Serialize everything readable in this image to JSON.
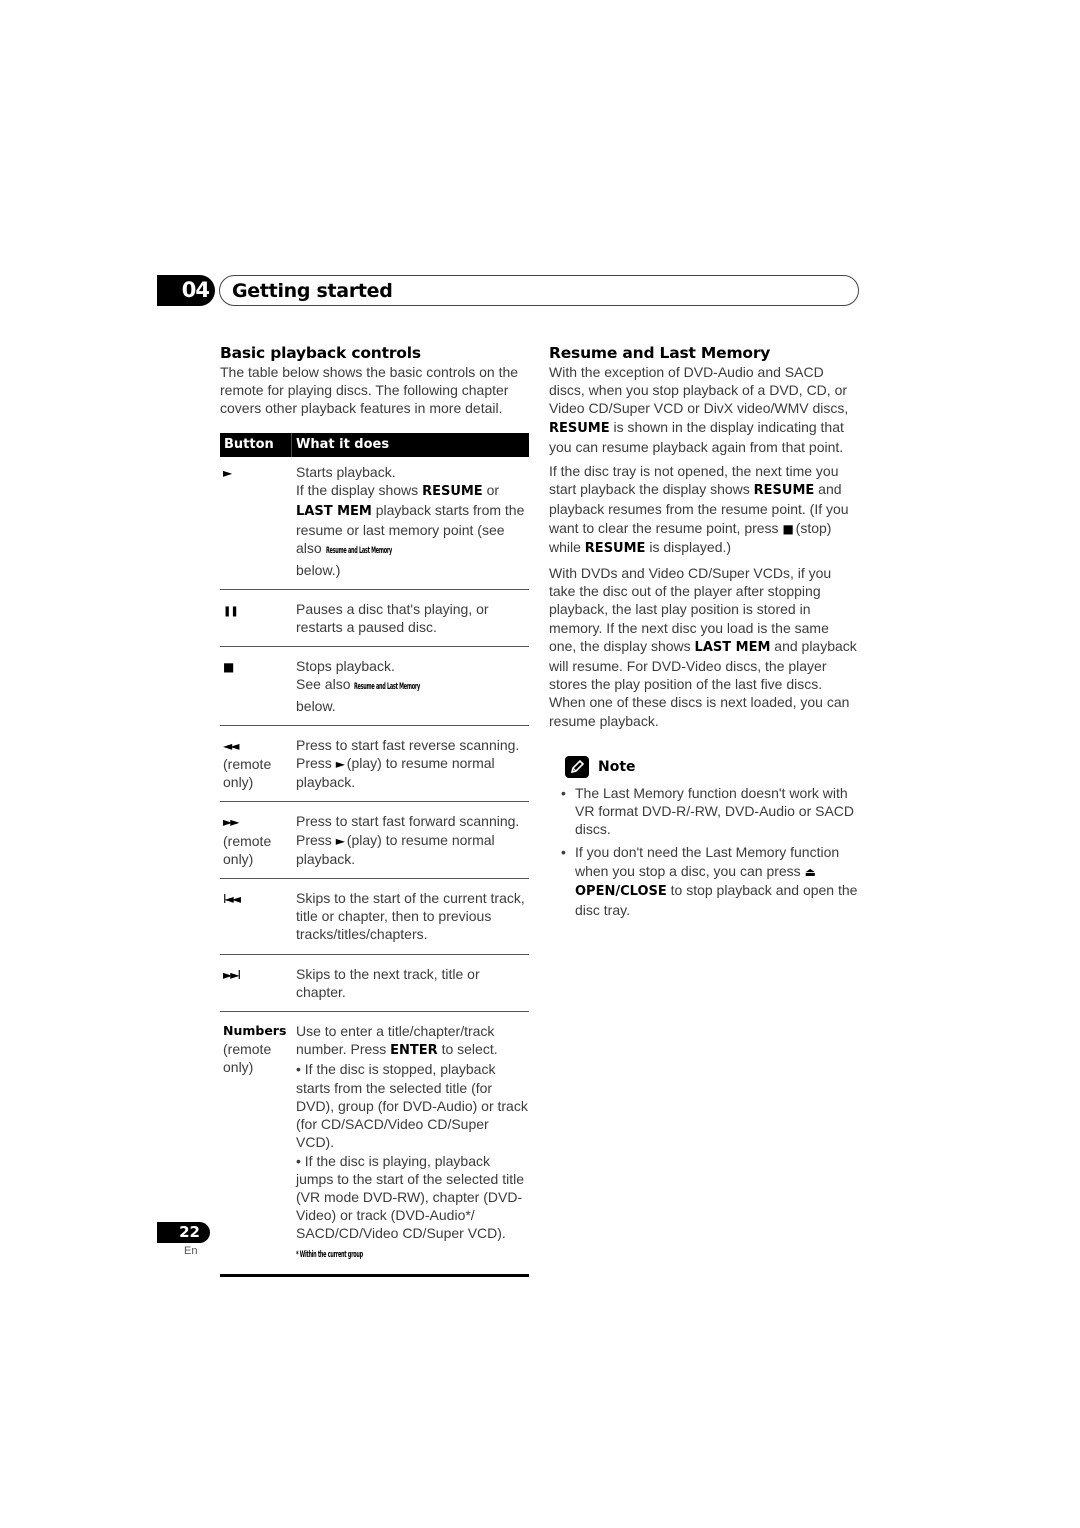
{
  "chapter": {
    "number": "04",
    "title": "Getting started"
  },
  "left": {
    "heading": "Basic playback controls",
    "intro": "The table below shows the basic controls on the remote for playing discs. The following chapter covers other playback features in more detail.",
    "table": {
      "headers": [
        "Button",
        "What it does"
      ],
      "rows": [
        {
          "icon": "play-icon",
          "glyph": "►",
          "sub": "",
          "lines": [
            "Starts playback.",
            "If the display shows ",
            "RESUME",
            " or ",
            "LAST MEM",
            " playback starts from the resume or last memory point (see also ",
            "Resume and Last Memory",
            "below.)"
          ]
        },
        {
          "icon": "pause-icon",
          "glyph": "❚❚",
          "sub": "",
          "text": "Pauses a disc that's playing, or restarts a paused disc."
        },
        {
          "icon": "stop-icon",
          "glyph": "■",
          "sub": "",
          "line1": "Stops playback.",
          "line2": "See also ",
          "ref": "Resume and Last Memory",
          "line3": "below."
        },
        {
          "icon": "fast-reverse-icon",
          "glyph": "◄◄",
          "sub": "(remote only)",
          "text1": "Press to start fast reverse scanning.",
          "text2a": "Press ",
          "text2b": "►",
          "text2c": " (play) to resume normal playback."
        },
        {
          "icon": "fast-forward-icon",
          "glyph": "►►",
          "sub": "(remote only)",
          "text1": "Press to start fast forward scanning.",
          "text2a": "Press ",
          "text2b": "►",
          "text2c": " (play) to resume normal playback."
        },
        {
          "icon": "skip-previous-icon",
          "glyph": "I◄◄",
          "sub": "",
          "text": "Skips to the start of the current track, title or chapter, then to previous tracks/titles/chapters."
        },
        {
          "icon": "skip-next-icon",
          "glyph": "►►I",
          "sub": "",
          "text": "Skips to the next track, title or chapter."
        },
        {
          "label": "Numbers",
          "sub": "(remote only)",
          "text1a": "Use to enter a title/chapter/track number. Press ",
          "text1b": "ENTER",
          "text1c": " to select.",
          "bullet1": "• If the disc is stopped, playback starts from the selected title (for DVD), group (for DVD-Audio) or track (for CD/SACD/Video CD/Super VCD).",
          "bullet2": "• If the disc is playing, playback jumps to the start of the selected title (VR mode DVD-RW), chapter (DVD-Video) or track (DVD-Audio*/ SACD/CD/Video CD/Super VCD).",
          "footnote": "* Within the current group"
        }
      ]
    }
  },
  "right": {
    "heading": "Resume and Last Memory",
    "p1a": "With the exception of DVD-Audio and SACD discs, when you stop playback of a DVD, CD, or Video CD/Super VCD or DivX video/WMV discs, ",
    "p1b": "RESUME",
    "p1c": " is shown in the display indicating that you can resume playback again from that point.",
    "p2a": "If the disc tray is not opened, the next time you start playback the display shows ",
    "p2b": "RESUME",
    "p2c": " and playback resumes from the resume point. (If you want to clear the resume point, press ",
    "p2d": "■",
    "p2e": " (stop) while ",
    "p2f": "RESUME",
    "p2g": " is displayed.)",
    "p3a": "With DVDs and Video CD/Super VCDs, if you take the disc out of the player after stopping playback, the last play position is stored in memory. If the next disc you load is the same one, the display shows ",
    "p3b": "LAST MEM",
    "p3c": " and playback will resume.  For DVD-Video discs, the player stores the play position of the last five discs. When one of these discs is next loaded, you can resume playback.",
    "note": {
      "title": "Note",
      "icon": "pencil-icon",
      "items": [
        {
          "text": "The Last Memory function doesn't work with VR format DVD-R/-RW, DVD-Audio or SACD discs."
        },
        {
          "a": "If you don't need the Last Memory function when you stop a disc, you can press ",
          "b": "⏏",
          "c": " ",
          "d": "OPEN/CLOSE",
          "e": " to stop playback and open the disc tray."
        }
      ]
    }
  },
  "footer": {
    "page": "22",
    "lang": "En"
  }
}
